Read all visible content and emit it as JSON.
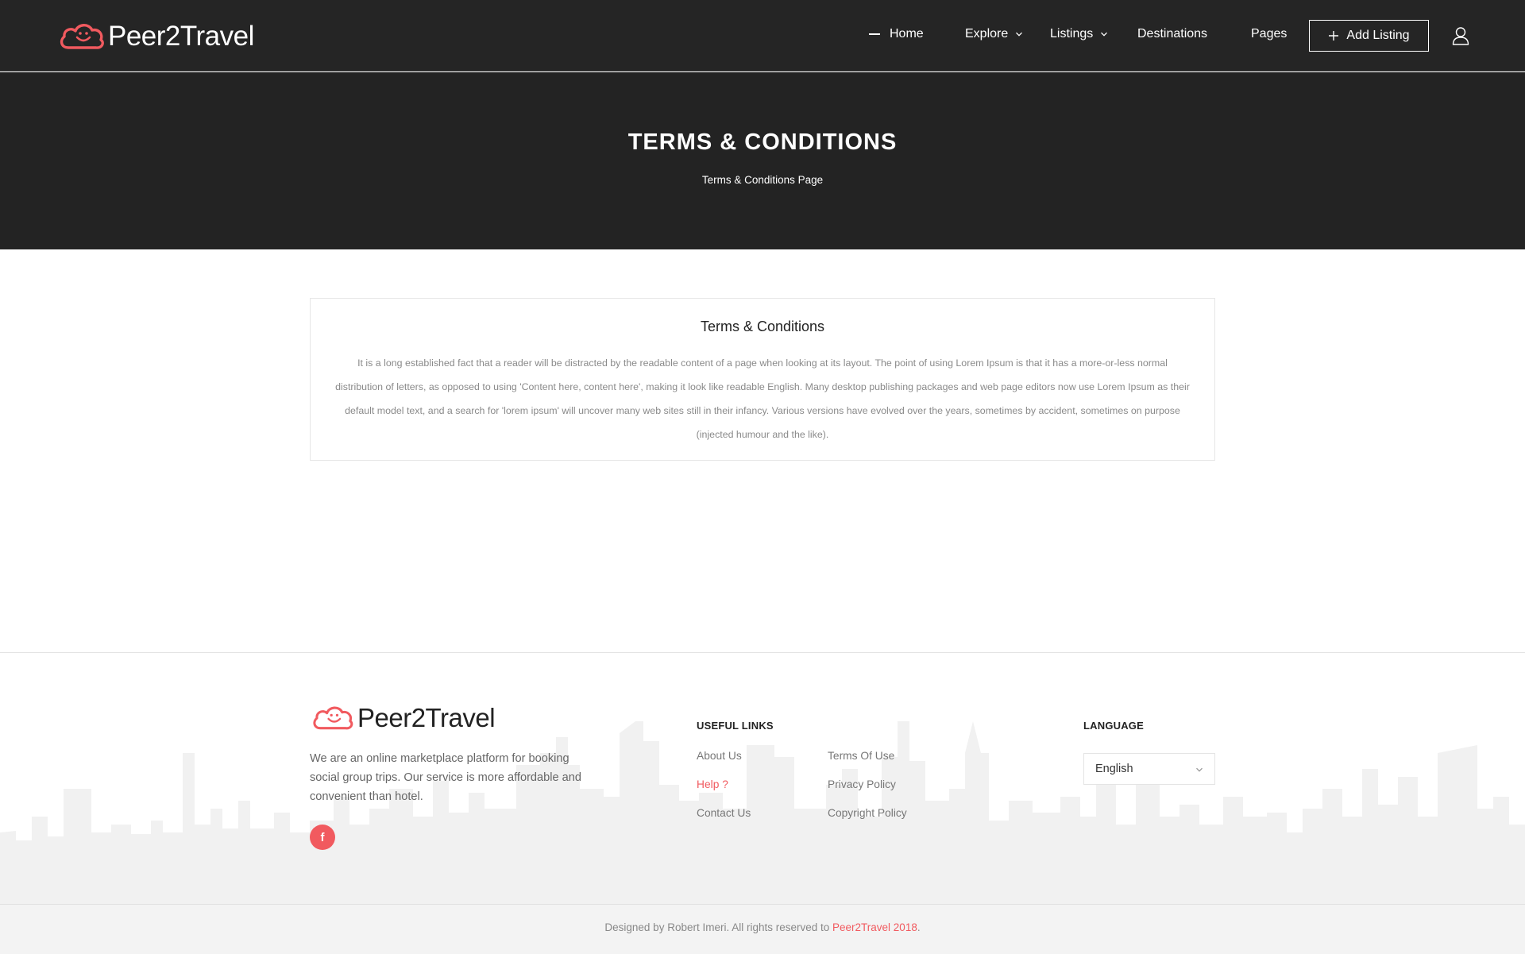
{
  "header": {
    "brand": "Peer2Travel",
    "nav": [
      {
        "label": "Home",
        "active": true,
        "dropdown": false
      },
      {
        "label": "Explore",
        "active": false,
        "dropdown": true
      },
      {
        "label": "Listings",
        "active": false,
        "dropdown": true
      },
      {
        "label": "Destinations",
        "active": false,
        "dropdown": false
      },
      {
        "label": "Pages",
        "active": false,
        "dropdown": false
      }
    ],
    "add_listing_label": "Add Listing",
    "icons": [
      "plus-icon",
      "user-icon",
      "chevron-down-icon"
    ]
  },
  "hero": {
    "title": "TERMS & CONDITIONS",
    "subtitle": "Terms & Conditions Page"
  },
  "content": {
    "title": "Terms & Conditions",
    "body": "It is a long established fact that a reader will be distracted by the readable content of a page when looking at its layout. The point of using Lorem Ipsum is that it has a more-or-less normal distribution of letters, as opposed to using 'Content here, content here', making it look like readable English. Many desktop publishing packages and web page editors now use Lorem Ipsum as their default model text, and a search for 'lorem ipsum' will uncover many web sites still in their infancy. Various versions have evolved over the years, sometimes by accident, sometimes on purpose (injected humour and the like)."
  },
  "footer": {
    "brand": "Peer2Travel",
    "description": "We are an online marketplace platform for booking social group trips. Our service is more affordable and convenient than hotel.",
    "social": "f",
    "useful_links_heading": "USEFUL LINKS",
    "links_col1": [
      "About Us",
      "Help ?",
      "Contact Us"
    ],
    "links_col2": [
      "Terms Of Use",
      "Privacy Policy",
      "Copyright Policy"
    ],
    "language_heading": "LANGUAGE",
    "language_value": "English",
    "copyright_prefix": "Designed by Robert Imeri. All rights reserved to ",
    "copyright_brand": "Peer2Travel 2018",
    "copyright_suffix": "."
  },
  "colors": {
    "accent": "#f15a5f",
    "header_bg": "#252525",
    "hero_bg": "#232323"
  }
}
